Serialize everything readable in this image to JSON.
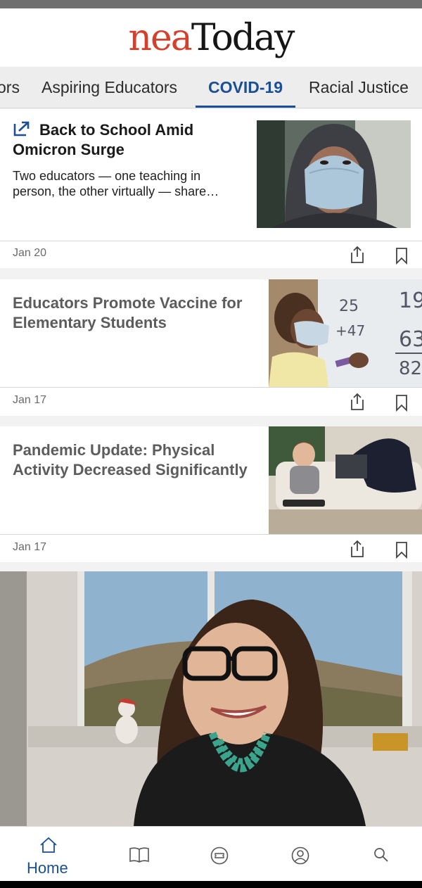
{
  "header": {
    "logo_part1": "nea",
    "logo_part2": "Today"
  },
  "tabs": [
    {
      "label": "ors"
    },
    {
      "label": "Aspiring Educators"
    },
    {
      "label": "COVID-19"
    },
    {
      "label": "Racial Justice"
    }
  ],
  "articles": [
    {
      "title": "Back to School Amid Omicron Surge",
      "excerpt": "Two educators — one teaching in person, the other virtually — share…",
      "date": "Jan 20",
      "icon": "external-link-icon"
    },
    {
      "title": "Educators Promote Vaccine for Elementary Students",
      "date": "Jan 17"
    },
    {
      "title": "Pandemic Update: Physical Activity Decreased Significantly",
      "date": "Jan 17"
    }
  ],
  "bottom_nav": {
    "home_label": "Home",
    "icons": [
      "home-icon",
      "book-icon",
      "ticket-icon",
      "profile-icon",
      "search-icon"
    ]
  },
  "colors": {
    "accent": "#1a4f93",
    "logo_red": "#d4402c"
  }
}
